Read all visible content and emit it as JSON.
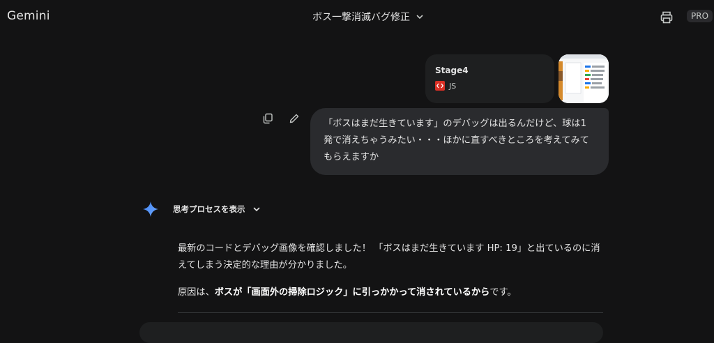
{
  "app": {
    "brand": "Gemini",
    "badge": "PRO"
  },
  "header": {
    "conversation_title": "ボス一撃消滅バグ修正"
  },
  "attachment": {
    "file_name": "Stage4",
    "file_type": "JS"
  },
  "user_message": {
    "text": "「ボスはまだ生きています」のデバッグは出るんだけど、球は1発で消えちゃうみたい・・・ほかに直すべきところを考えてみてもらえますか"
  },
  "response": {
    "thinking_label": "思考プロセスを表示",
    "paragraph1": "最新のコードとデバッグ画像を確認しました！ 「ボスはまだ生きています HP: 19」と出ているのに消えてしまう決定的な理由が分かりました。",
    "paragraph2_prefix": "原因は、",
    "paragraph2_bold": "ボスが「画面外の掃除ロジック」に引っかかって消されているから",
    "paragraph2_suffix": "です。"
  },
  "colors": {
    "background": "#131314",
    "bubble": "#2a2b2e",
    "card": "#1e1f20",
    "accent_spark": "#4285f4",
    "js_icon": "#d93025"
  },
  "icons": [
    "chevron-down-icon",
    "print-icon",
    "code-icon",
    "copy-icon",
    "edit-icon",
    "gemini-spark-icon"
  ]
}
